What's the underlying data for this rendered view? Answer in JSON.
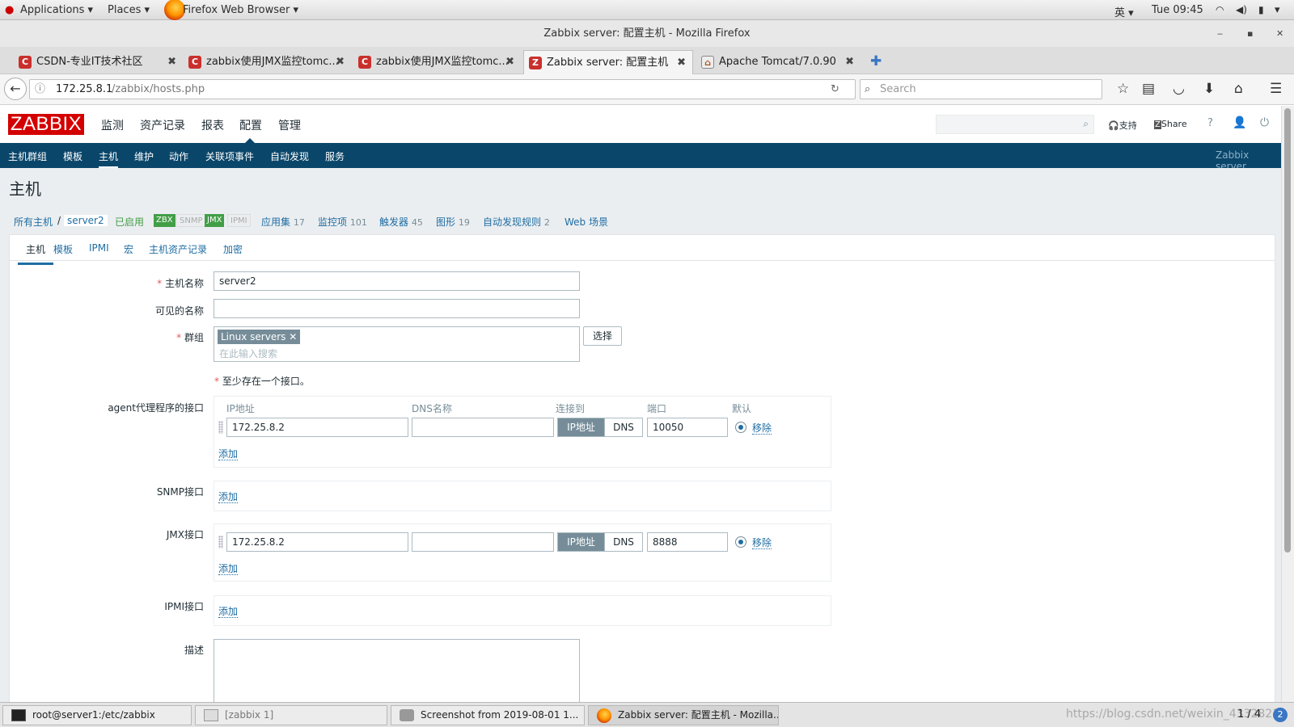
{
  "desktop": {
    "applications": "Applications",
    "places": "Places",
    "active_app": "Firefox Web Browser",
    "ime": "英",
    "clock": "Tue 09:45"
  },
  "window": {
    "title": "Zabbix server: 配置主机 - Mozilla Firefox"
  },
  "tabs": [
    {
      "label": "CSDN-专业IT技术社区"
    },
    {
      "label": "zabbix使用JMX监控tomc..."
    },
    {
      "label": "zabbix使用JMX监控tomc..."
    },
    {
      "label": "Zabbix server: 配置主机"
    },
    {
      "label": "Apache Tomcat/7.0.90"
    }
  ],
  "url": {
    "host": "172.25.8.1",
    "path": "/zabbix/hosts.php"
  },
  "browser_search": {
    "placeholder": "Search"
  },
  "zabbix": {
    "logo": "ZABBIX",
    "main_menu": [
      "监测",
      "资产记录",
      "报表",
      "配置",
      "管理"
    ],
    "support": "支持",
    "share": "Share",
    "help": "?",
    "sub_menu": [
      "主机群组",
      "模板",
      "主机",
      "维护",
      "动作",
      "关联项事件",
      "自动发现",
      "服务"
    ],
    "server_name": "Zabbix server"
  },
  "page": {
    "title": "主机",
    "crumbs": {
      "all_hosts": "所有主机",
      "host": "server2",
      "status": "已启用",
      "badges": [
        "ZBX",
        "SNMP",
        "JMX",
        "IPMI"
      ],
      "apps": "应用集",
      "apps_n": "17",
      "items": "监控项",
      "items_n": "101",
      "triggers": "触发器",
      "triggers_n": "45",
      "graphs": "图形",
      "graphs_n": "19",
      "discovery": "自动发现规则",
      "discovery_n": "2",
      "web": "Web 场景"
    },
    "form_tabs": [
      "主机",
      "模板",
      "IPMI",
      "宏",
      "主机资产记录",
      "加密"
    ]
  },
  "form": {
    "host_name_label": "主机名称",
    "host_name": "server2",
    "visible_name_label": "可见的名称",
    "visible_name": "",
    "groups_label": "群组",
    "group_tag": "Linux servers",
    "groups_placeholder": "在此输入搜索",
    "select_button": "选择",
    "iface_note": "至少存在一个接口。",
    "agent_label": "agent代理程序的接口",
    "col_ip": "IP地址",
    "col_dns": "DNS名称",
    "col_connect": "连接到",
    "col_port": "端口",
    "col_default": "默认",
    "agent_ip": "172.25.8.2",
    "agent_dns": "",
    "agent_port": "10050",
    "jmx_ip": "172.25.8.2",
    "jmx_dns": "",
    "jmx_port": "8888",
    "conn_ip": "IP地址",
    "conn_dns": "DNS",
    "remove": "移除",
    "add": "添加",
    "snmp_label": "SNMP接口",
    "jmx_label": "JMX接口",
    "ipmi_label": "IPMI接口",
    "desc_label": "描述"
  },
  "taskbar": [
    {
      "label": "root@server1:/etc/zabbix"
    },
    {
      "label": "[zabbix 1]"
    },
    {
      "label": "Screenshot from 2019-08-01 1..."
    },
    {
      "label": "Zabbix server: 配置主机 - Mozilla..."
    }
  ],
  "watermark": "https://blog.csdn.net/weixin_43328213",
  "workspace": "1 / 4"
}
